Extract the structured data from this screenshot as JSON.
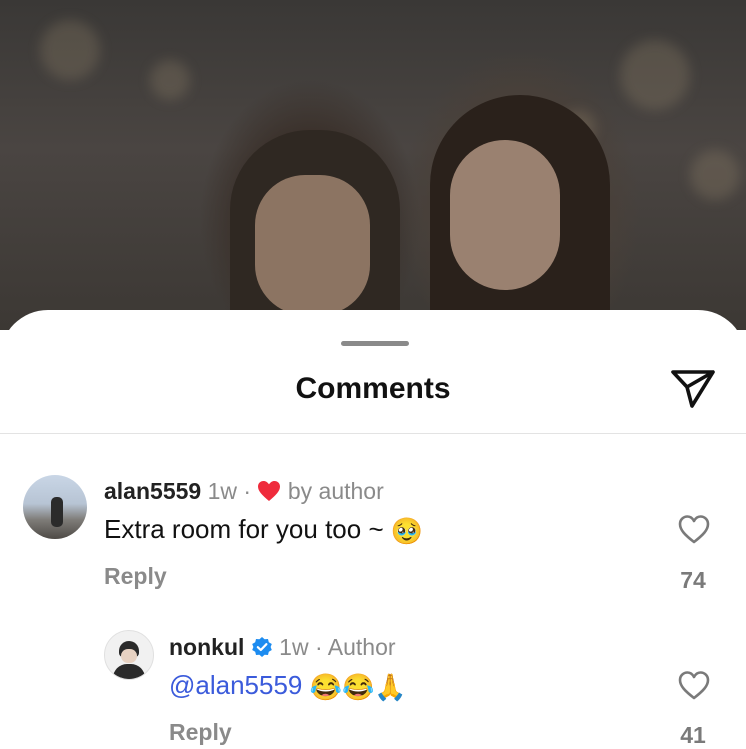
{
  "sheet": {
    "title": "Comments"
  },
  "comments": [
    {
      "username": "alan5559",
      "time": "1w",
      "separator": "·",
      "liked_label": "by author",
      "text": "Extra room for you too ~",
      "emoji": "🥹",
      "reply_label": "Reply",
      "likes": "74"
    },
    {
      "username": "nonkul",
      "time": "1w",
      "separator": "·",
      "author_label": "Author",
      "mention": "@alan5559",
      "emojis": "😂😂🙏",
      "reply_label": "Reply",
      "likes": "41"
    }
  ],
  "colors": {
    "liked_heart": "#ef2b3c",
    "verified": "#1d8cf0",
    "mention": "#3b5bdb"
  },
  "icons": [
    "send-icon",
    "heart-icon",
    "verified-badge-icon",
    "liked-by-author-heart-icon"
  ]
}
